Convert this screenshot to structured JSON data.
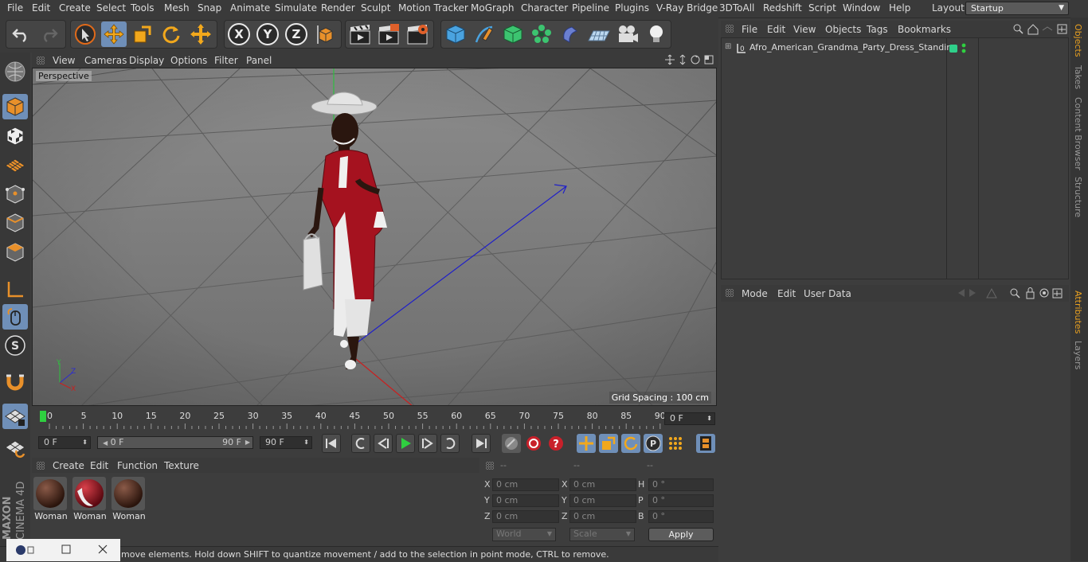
{
  "menubar": {
    "items": [
      "File",
      "Edit",
      "Create",
      "Select",
      "Tools",
      "Mesh",
      "Snap",
      "Animate",
      "Simulate",
      "Render",
      "Sculpt",
      "Motion Tracker",
      "MoGraph",
      "Character",
      "Pipeline",
      "Plugins",
      "V-Ray Bridge",
      "3DToAll",
      "Redshift",
      "Script",
      "Window",
      "Help"
    ],
    "layout_label": "Layout:",
    "layout_value": "Startup"
  },
  "toolbar": {
    "axis_x": "X",
    "axis_y": "Y",
    "axis_z": "Z"
  },
  "viewport": {
    "menu": [
      "View",
      "Cameras",
      "Display",
      "Options",
      "Filter",
      "Panel"
    ],
    "camera_label": "Perspective",
    "grid_spacing": "Grid Spacing : 100 cm"
  },
  "timeline": {
    "ticks": [
      "0",
      "5",
      "10",
      "15",
      "20",
      "25",
      "30",
      "35",
      "40",
      "45",
      "50",
      "55",
      "60",
      "65",
      "70",
      "75",
      "80",
      "85",
      "90"
    ],
    "current_frame": "0 F",
    "start_field": "0 F",
    "range_start": "0 F",
    "range_end": "90 F",
    "end_field": "90 F"
  },
  "materials": {
    "menu": [
      "Create",
      "Edit",
      "Function",
      "Texture"
    ],
    "items": [
      {
        "label": "Woman"
      },
      {
        "label": "Woman"
      },
      {
        "label": "Woman"
      }
    ]
  },
  "coordinates": {
    "headers": [
      "--",
      "--",
      "--"
    ],
    "rows": [
      {
        "a": "X",
        "av": "0 cm",
        "b": "X",
        "bv": "0 cm",
        "c": "H",
        "cv": "0 °"
      },
      {
        "a": "Y",
        "av": "0 cm",
        "b": "Y",
        "bv": "0 cm",
        "c": "P",
        "cv": "0 °"
      },
      {
        "a": "Z",
        "av": "0 cm",
        "b": "Z",
        "bv": "0 cm",
        "c": "B",
        "cv": "0 °"
      }
    ],
    "world": "World",
    "scale": "Scale",
    "apply": "Apply"
  },
  "status": {
    "text": "move elements. Hold down SHIFT to quantize movement / add to the selection in point mode, CTRL to remove."
  },
  "objects": {
    "menu": [
      "File",
      "Edit",
      "View",
      "Objects",
      "Tags",
      "Bookmarks"
    ],
    "items": [
      {
        "name": "Afro_American_Grandma_Party_Dress_Standing"
      }
    ]
  },
  "attributes": {
    "menu": [
      "Mode",
      "Edit",
      "User Data"
    ]
  },
  "right_tabs": [
    "Objects",
    "Takes",
    "Content Browser",
    "Structure",
    "Attributes",
    "Layers"
  ],
  "brand": {
    "line1": "MAXON",
    "line2": "CINEMA 4D"
  },
  "colors": {
    "accent": "#6f8fb8",
    "active_tab": "#e8a020",
    "dress": "#a5121f"
  }
}
